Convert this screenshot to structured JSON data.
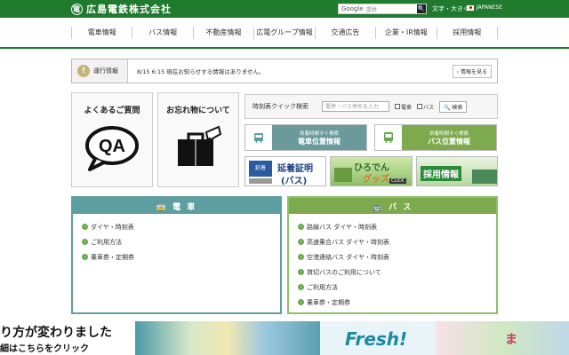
{
  "header": {
    "logo_text": "広島電鉄株式会社",
    "logo_mark": "電",
    "search_engine_label": "Google",
    "search_placeholder": "提供",
    "search_button_glyph": "🔍",
    "font_size_label": "文字・大きく",
    "language_label": "JAPANESE"
  },
  "nav": {
    "items": [
      "電車情報",
      "バス情報",
      "不動産情報",
      "広電グループ情報",
      "交通広告",
      "企業・IR情報",
      "採用情報"
    ]
  },
  "operation": {
    "icon_glyph": "!",
    "label": "運行情報",
    "message": "8/15 6:15 現在お知らせする情報はありません。",
    "more_label": "› 情報を見る"
  },
  "cards": {
    "faq_title": "よくあるご質問",
    "faq_graphic_text": "QA",
    "lost_title": "お忘れ物について"
  },
  "timetable_search": {
    "label": "時刻表クイック検索",
    "placeholder": "電停・バス停名を入力",
    "check_tram": "電車",
    "check_bus": "バス",
    "button": "🔍 検索"
  },
  "locators": {
    "tram_sub": "到着時間すぐ検索",
    "tram_main": "電車位置情報",
    "bus_sub": "到着時間すぐ検索",
    "bus_main": "バス位置情報"
  },
  "banners": {
    "cert_title": "延着証明",
    "cert_sub": "(バス)",
    "cert_badge": "延着",
    "goods_title": "ひろでん",
    "goods_sub": "グッズ",
    "goods_click": "CLICK",
    "recruit_title": "採用情報"
  },
  "tram_panel": {
    "header": "🚋 電 車",
    "items": [
      "ダイヤ・時刻表",
      "ご利用方法",
      "乗車券・定期券"
    ]
  },
  "bus_panel": {
    "header": "🚌 バ ス",
    "items": [
      "路線バス ダイヤ・時刻表",
      "高速乗合バス ダイヤ・時刻表",
      "空港連絡バス ダイヤ・時刻表",
      "貸切バスのご利用について",
      "ご利用方法",
      "乗車券・定期券"
    ]
  },
  "slider": {
    "slide1_line1": "り方が変わりました",
    "slide1_line2": "細はこちらをクリック",
    "slide3_text": "Fresh!",
    "slide4_text": "ま"
  },
  "colors": {
    "brand_green": "#1f7a2e",
    "tram_teal": "#5f9ea0",
    "bus_green": "#6aa84f"
  }
}
